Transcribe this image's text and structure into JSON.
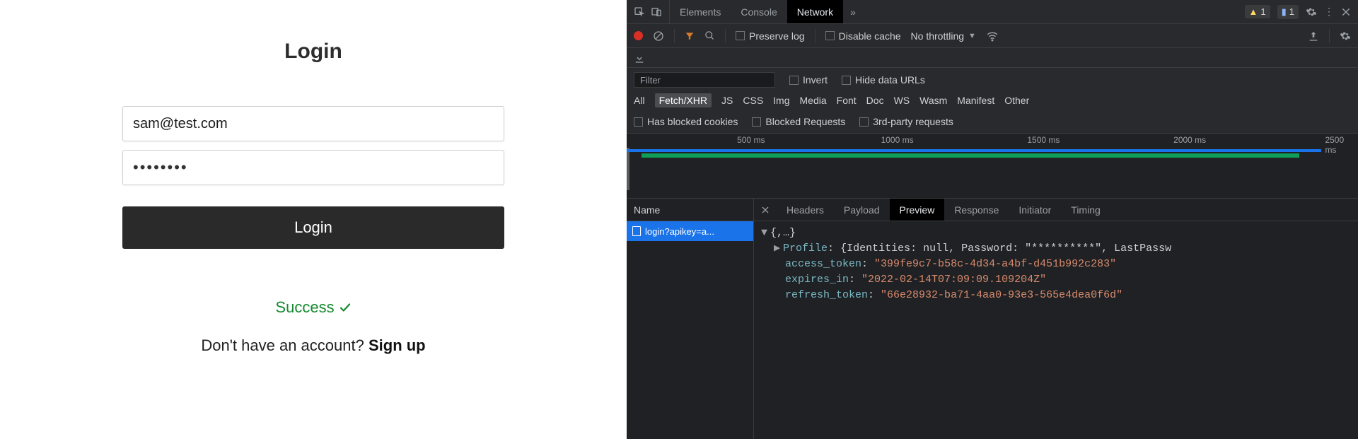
{
  "login": {
    "title": "Login",
    "email_value": "sam@test.com",
    "password_value": "••••••••",
    "button_label": "Login",
    "success_text": "Success",
    "signup_prompt": "Don't have an account? ",
    "signup_link": "Sign up"
  },
  "devtools": {
    "tabs": {
      "elements": "Elements",
      "console": "Console",
      "network": "Network"
    },
    "warn_count": "1",
    "info_count": "1",
    "toolbar": {
      "preserve_log": "Preserve log",
      "disable_cache": "Disable cache",
      "throttling": "No throttling"
    },
    "filter": {
      "placeholder": "Filter",
      "invert": "Invert",
      "hide_data_urls": "Hide data URLs",
      "types": [
        "All",
        "Fetch/XHR",
        "JS",
        "CSS",
        "Img",
        "Media",
        "Font",
        "Doc",
        "WS",
        "Wasm",
        "Manifest",
        "Other"
      ],
      "active_type": "Fetch/XHR",
      "has_blocked_cookies": "Has blocked cookies",
      "blocked_requests": "Blocked Requests",
      "third_party": "3rd-party requests"
    },
    "timeline": {
      "ticks": [
        "500 ms",
        "1000 ms",
        "1500 ms",
        "2000 ms",
        "2500 ms"
      ]
    },
    "requests": {
      "name_header": "Name",
      "rows": [
        {
          "label": "login?apikey=a..."
        }
      ]
    },
    "detail_tabs": {
      "headers": "Headers",
      "payload": "Payload",
      "preview": "Preview",
      "response": "Response",
      "initiator": "Initiator",
      "timing": "Timing"
    },
    "preview": {
      "root": "{,…}",
      "profile_key": "Profile",
      "profile_val": "{Identities: null, Password: \"**********\", LastPassw",
      "access_token_key": "access_token",
      "access_token_val": "\"399fe9c7-b58c-4d34-a4bf-d451b992c283\"",
      "expires_in_key": "expires_in",
      "expires_in_val": "\"2022-02-14T07:09:09.109204Z\"",
      "refresh_token_key": "refresh_token",
      "refresh_token_val": "\"66e28932-ba71-4aa0-93e3-565e4dea0f6d\""
    }
  }
}
